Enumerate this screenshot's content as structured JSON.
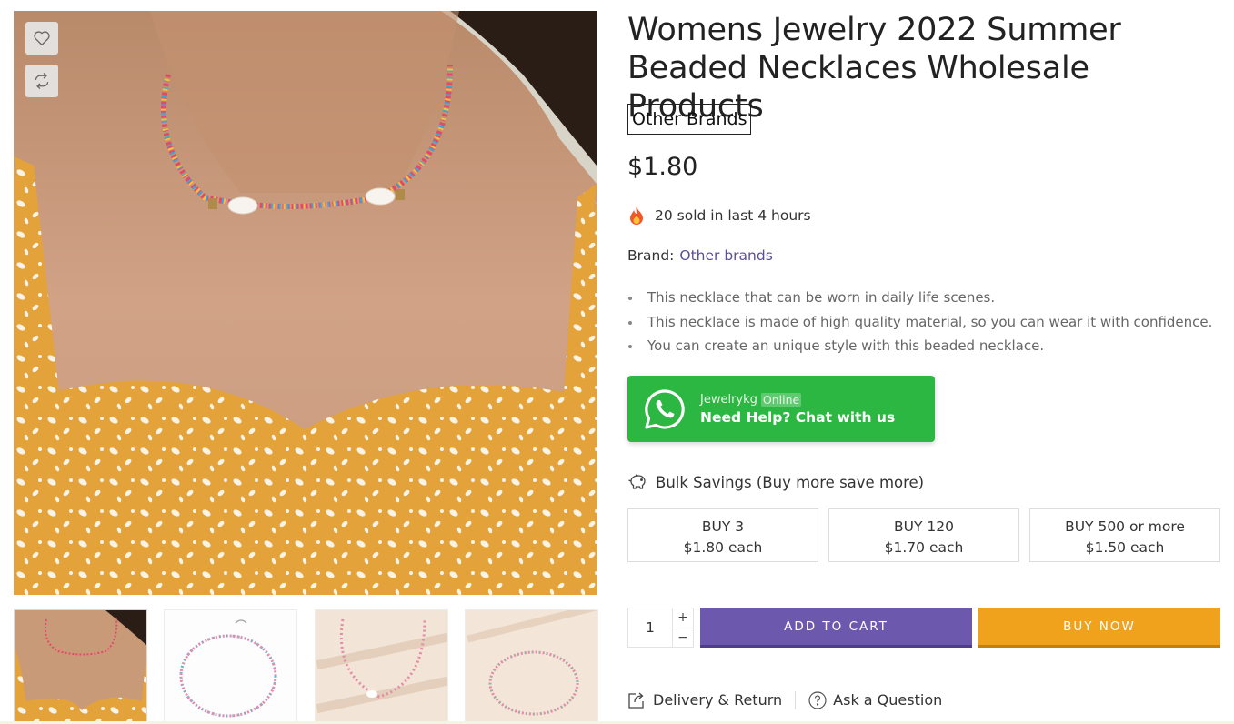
{
  "gallery": {
    "wishlist_icon": "heart-icon",
    "compare_icon": "compare-arrows-icon",
    "main_image_alt": "Woman wearing colorful beaded necklace with pearls",
    "thumbnail_count": 4
  },
  "product": {
    "title": "Womens Jewelry 2022 Summer Beaded Necklaces Wholesale Products",
    "brand_badge": "Other Brands",
    "price": "$1.80",
    "sold_text": "20 sold in last 4 hours",
    "brand_label": "Brand:",
    "brand_link": "Other brands",
    "features": [
      "This necklace that can be worn in daily life scenes.",
      "This necklace is made of high quality material, so you can wear it with confidence.",
      "You can create an unique style with this beaded necklace."
    ]
  },
  "whatsapp": {
    "agent": "Jewelrykg",
    "status": "Online",
    "cta": "Need Help? Chat with us",
    "color": "#2cb742"
  },
  "bulk": {
    "title": "Bulk Savings (Buy more save more)",
    "tiers": [
      {
        "qty": "BUY 3",
        "price": "$1.80 each"
      },
      {
        "qty": "BUY 120",
        "price": "$1.70 each"
      },
      {
        "qty": "BUY 500 or more",
        "price": "$1.50 each"
      }
    ]
  },
  "purchase": {
    "quantity": "1",
    "plus": "+",
    "minus": "−",
    "add_to_cart": "ADD TO CART",
    "buy_now": "BUY NOW",
    "cart_color": "#6c58ad",
    "buy_color": "#f0a21d"
  },
  "links": {
    "delivery": "Delivery & Return",
    "ask": "Ask a Question"
  }
}
